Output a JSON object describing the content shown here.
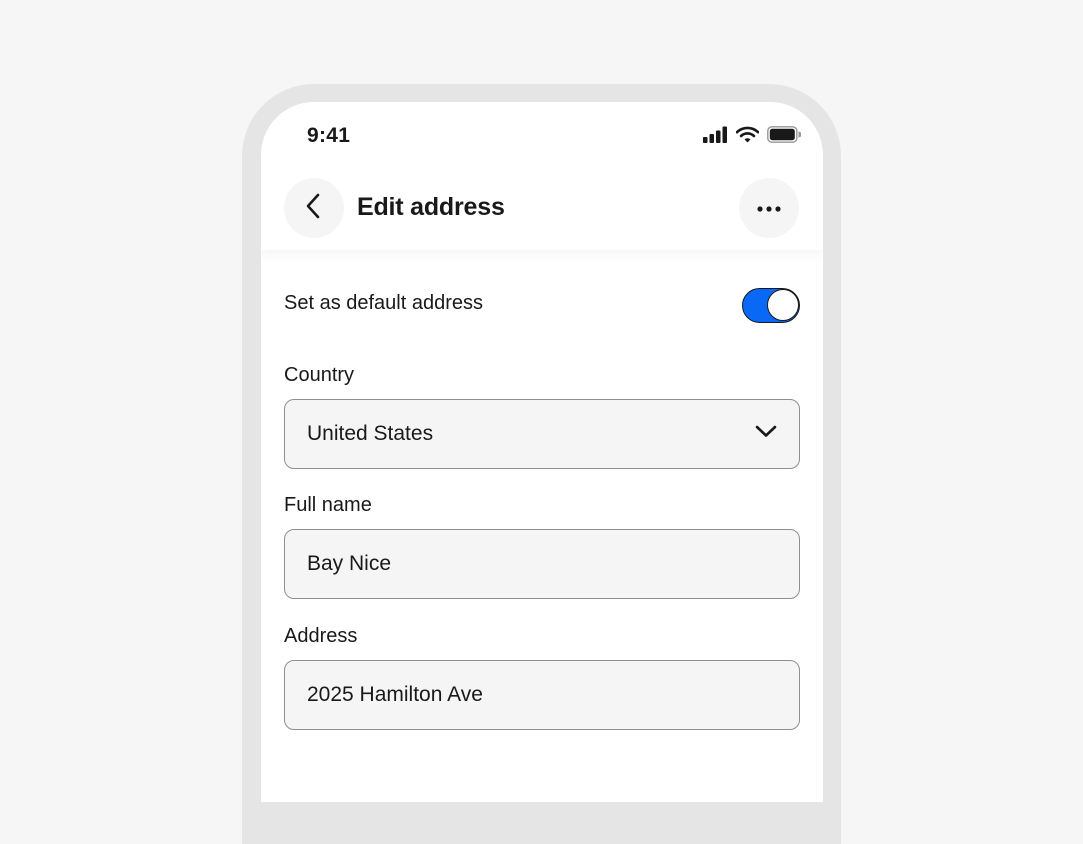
{
  "status_bar": {
    "time": "9:41",
    "icons": [
      "cellular-signal-icon",
      "wifi-icon",
      "battery-icon"
    ]
  },
  "header": {
    "title": "Edit address",
    "back_icon": "chevron-left-icon",
    "more_icon": "more-horizontal-icon"
  },
  "default_address": {
    "label": "Set as default address",
    "toggle_on": true
  },
  "fields": {
    "country": {
      "label": "Country",
      "value": "United States",
      "icon": "chevron-down-icon"
    },
    "full_name": {
      "label": "Full name",
      "value": "Bay Nice"
    },
    "address": {
      "label": "Address",
      "value": "2025 Hamilton Ave"
    }
  },
  "colors": {
    "accent": "#0968f6",
    "background": "#f6f6f6",
    "frame": "#e5e5e5",
    "field_fill": "#f5f5f5",
    "field_border": "#8f8f8f",
    "text": "#191919"
  }
}
